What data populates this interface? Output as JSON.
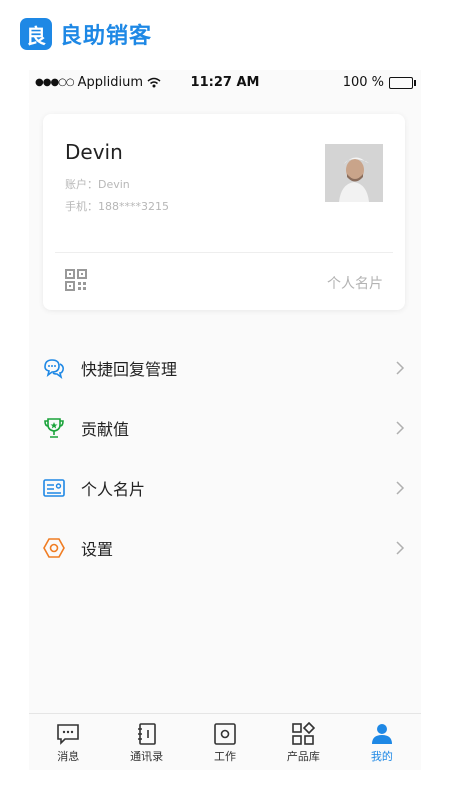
{
  "brand": {
    "name": "良助销客",
    "logo_glyph": "良",
    "color": "#1e88e5"
  },
  "status_bar": {
    "signal": "●●●○○",
    "carrier": "Applidium",
    "time": "11:27 AM",
    "battery": "100 %"
  },
  "profile": {
    "name": "Devin",
    "account": "账户：Devin",
    "phone": "手机：188****3215",
    "card_label": "个人名片"
  },
  "menu": {
    "items": [
      {
        "label": "快捷回复管理",
        "icon": "chat-bubbles-icon",
        "color": "#1e88e5"
      },
      {
        "label": "贡献值",
        "icon": "trophy-icon",
        "color": "#1aa33a"
      },
      {
        "label": "个人名片",
        "icon": "id-card-icon",
        "color": "#1e88e5"
      },
      {
        "label": "设置",
        "icon": "hexagon-settings-icon",
        "color": "#f07c22"
      }
    ]
  },
  "tabbar": {
    "tabs": [
      {
        "label": "消息",
        "icon": "message-icon"
      },
      {
        "label": "通讯录",
        "icon": "contacts-book-icon"
      },
      {
        "label": "工作",
        "icon": "work-icon"
      },
      {
        "label": "产品库",
        "icon": "product-grid-icon"
      },
      {
        "label": "我的",
        "icon": "person-icon",
        "active": true
      }
    ],
    "active_color": "#1e88e5"
  }
}
